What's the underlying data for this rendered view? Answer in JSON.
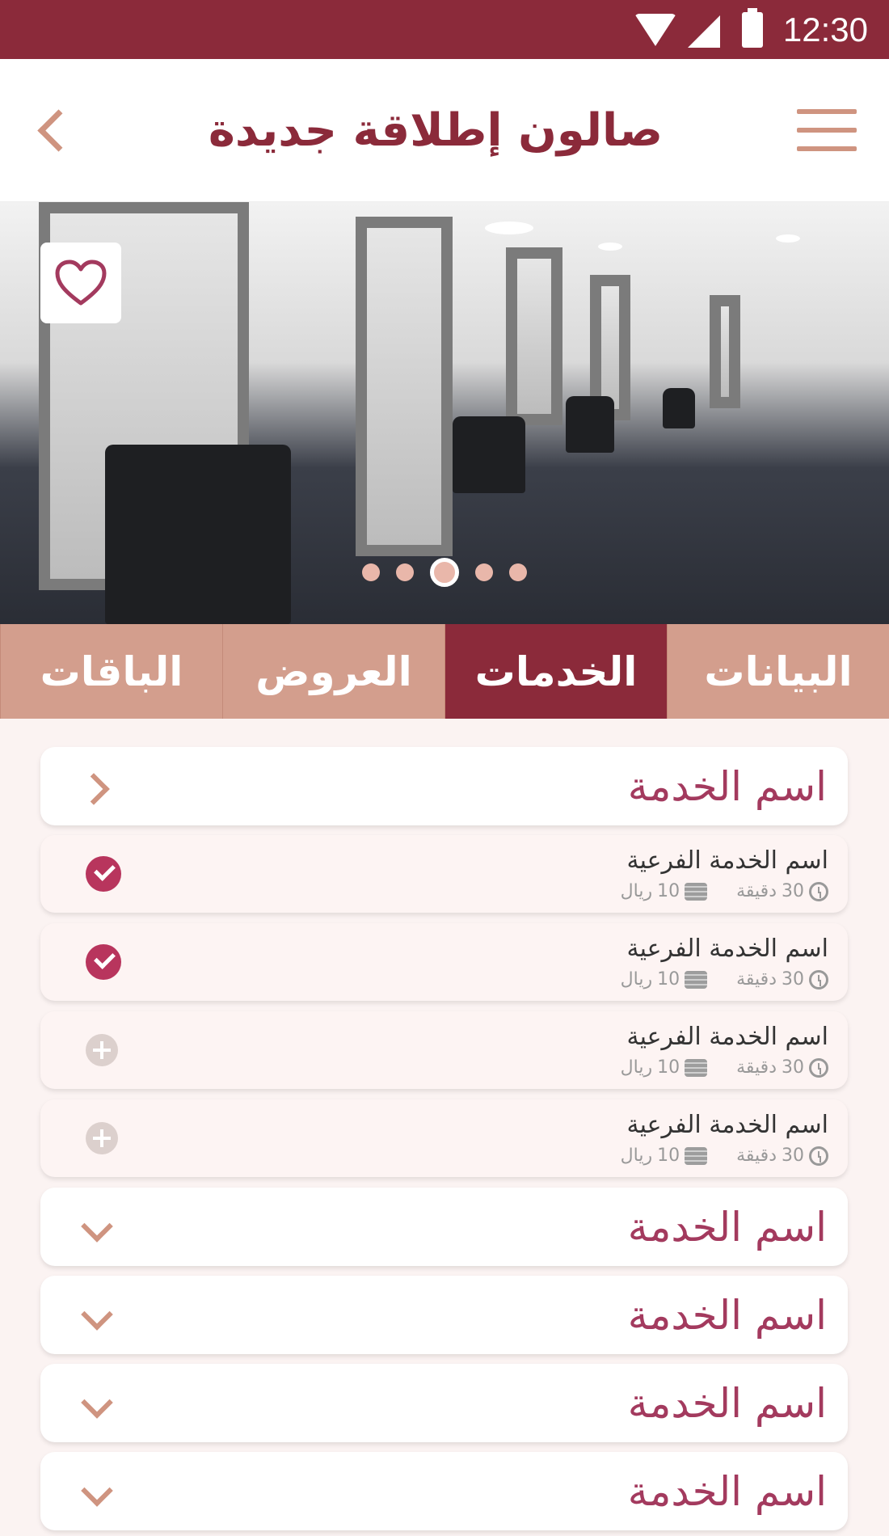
{
  "status_bar": {
    "time": "12:30"
  },
  "header": {
    "title": "صالون إطلاقة جديدة"
  },
  "carousel": {
    "slide_count": 5,
    "active_slide": 3
  },
  "tabs": [
    {
      "label": "البيانات",
      "active": false
    },
    {
      "label": "الخدمات",
      "active": true
    },
    {
      "label": "العروض",
      "active": false
    },
    {
      "label": "الباقات",
      "active": false
    }
  ],
  "services": {
    "expanded": {
      "name": "اسم الخدمة",
      "sub_items": [
        {
          "name": "اسم الخدمة الفرعية",
          "duration_value": "30",
          "duration_unit": "دقيقة",
          "price_value": "10",
          "price_unit": "ريال",
          "selected": true
        },
        {
          "name": "اسم الخدمة الفرعية",
          "duration_value": "30",
          "duration_unit": "دقيقة",
          "price_value": "10",
          "price_unit": "ريال",
          "selected": true
        },
        {
          "name": "اسم الخدمة الفرعية",
          "duration_value": "30",
          "duration_unit": "دقيقة",
          "price_value": "10",
          "price_unit": "ريال",
          "selected": false
        },
        {
          "name": "اسم الخدمة الفرعية",
          "duration_value": "30",
          "duration_unit": "دقيقة",
          "price_value": "10",
          "price_unit": "ريال",
          "selected": false
        }
      ]
    },
    "collapsed": [
      {
        "name": "اسم الخدمة"
      },
      {
        "name": "اسم الخدمة"
      },
      {
        "name": "اسم الخدمة"
      },
      {
        "name": "اسم الخدمة"
      }
    ]
  },
  "colors": {
    "primary": "#8b2a3a",
    "accent": "#cf9480",
    "tab_bg": "#d39e8d",
    "selected_check": "#b8355d",
    "service_text": "#a33a5e"
  }
}
